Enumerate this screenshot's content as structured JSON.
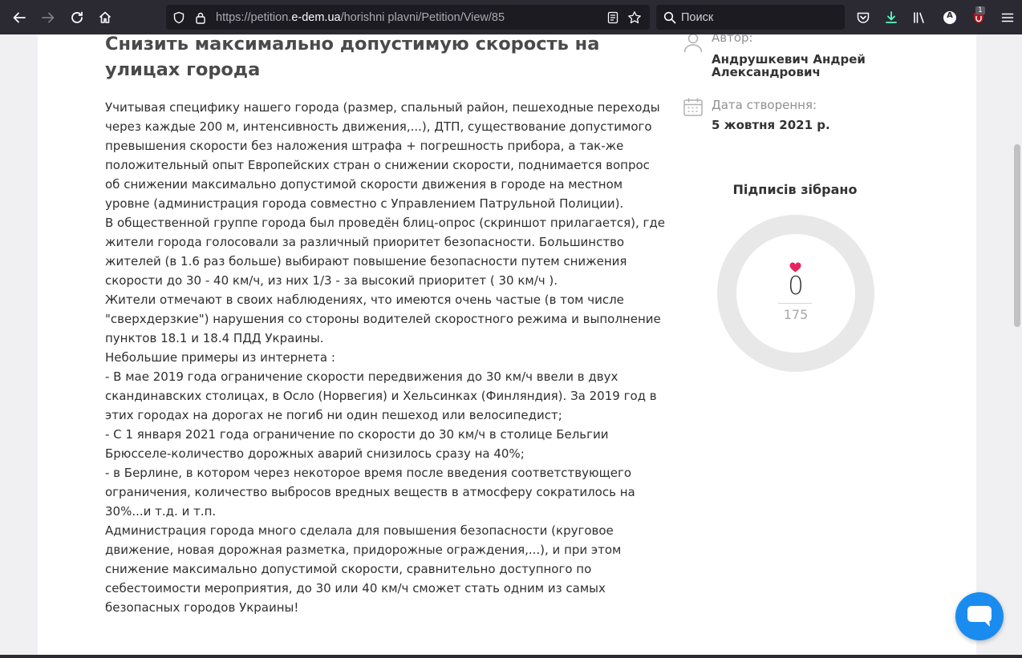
{
  "browser": {
    "url_prefix": "https://petition.",
    "url_host": "e-dem.ua",
    "url_path": "/horishni plavni/Petition/View/85",
    "search_placeholder": "Поиск",
    "extension_badge": "1",
    "account_initial": "A"
  },
  "petition": {
    "title": "Снизить максимально допустимую скорость на улицах города",
    "paragraphs": [
      "Учитывая специфику нашего города (размер, спальный район, пешеходные переходы через каждые 200 м, интенсивность движения,...), ДТП, существование допустимого превышения скорости без наложения штрафа + погрешность прибора, а так-же положительный опыт Европейских стран о снижении скорости, поднимается вопрос об снижении максимально допустимой скорости движения в городе на местном уровне (администрация города совместно с Управлением Патрульной Полиции).",
      "В общественной группе города был проведён блиц-опрос (скриншот прилагается), где жители города голосовали за различный приоритет безопасности. Большинство жителей (в 1.6 раз больше) выбирают повышение безопасности путем снижения скорости до 30 - 40 км/ч, из них 1/3 - за высокий приоритет ( 30 км/ч ).",
      "Жители отмечают в своих наблюдениях, что имеются очень частые (в том числе \"сверхдерзкие\") нарушения со стороны водителей скоростного режима и выполнение пунктов 18.1 и 18.4 ПДД Украины.",
      "Небольшие примеры из интернета :",
      "- В мае 2019 года ограничение скорости передвижения до 30 км/ч ввели в двух скандинавских столицах, в Осло (Норвегия) и Хельсинках (Финляндия). За 2019 год в этих городах на дорогах не погиб ни один пешеход или велосипедист;",
      "- С 1 января 2021 года ограничение по скорости до 30 км/ч в столице Бельгии Брюсселе-количество дорожных аварий снизилось сразу на 40%;",
      "- в Берлине, в котором через некоторое время после введения соответствующего ограничения, количество выбросов вредных веществ в атмосферу сократилось на 30%...и т.д. и т.п.",
      "Администрация города много сделала для повышения безопасности (круговое движение, новая дорожная разметка, придорожные ограждения,...), и при этом снижение максимально допустимой скорости, сравнительно доступного по себестоимости мероприятия, до 30 или 40 км/ч сможет стать одним из самых безопасных городов Украины!"
    ],
    "author_label": "Автор:",
    "author_name": "Андрушкевич Андрей Александрович",
    "date_label": "Дата створення:",
    "date_value": "5 жовтня 2021 р.",
    "signatures_title": "Підписів зібрано",
    "signatures_count": "0",
    "signatures_goal": "175",
    "progress_fraction": 0
  },
  "colors": {
    "accent_blue": "#1a8cf0",
    "heart": "#e8245c",
    "ring": "#e8e8e8"
  }
}
